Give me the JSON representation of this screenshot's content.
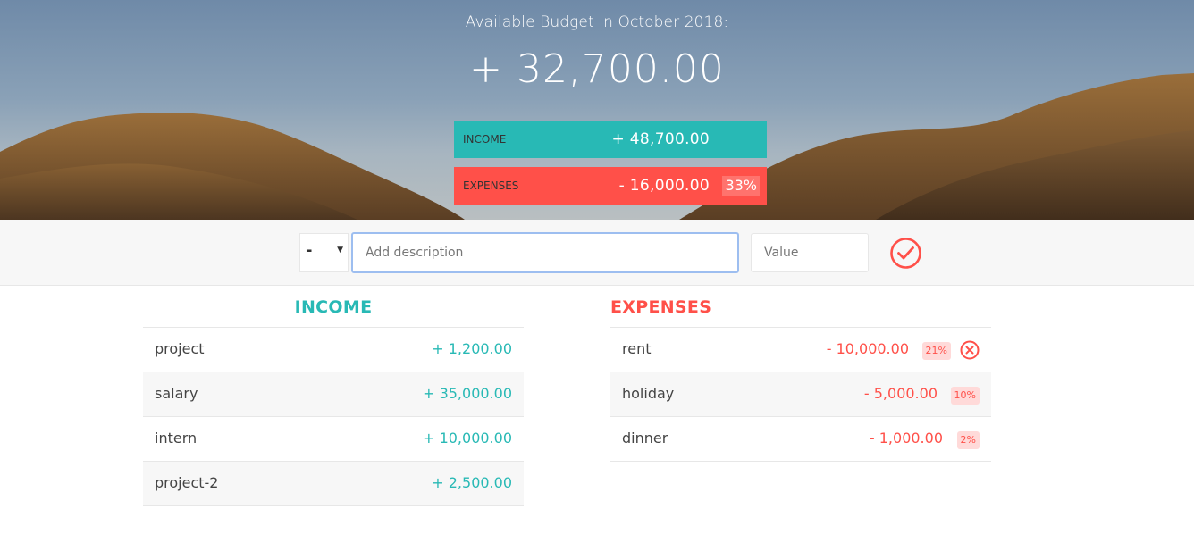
{
  "header": {
    "title": "Available Budget in October 2018:",
    "budget": "+ 32,700.00",
    "income": {
      "label": "INCOME",
      "value": "+ 48,700.00"
    },
    "expenses": {
      "label": "EXPENSES",
      "value": "- 16,000.00",
      "percentage": "33%"
    }
  },
  "add_form": {
    "type_selected": "-",
    "description_placeholder": "Add description",
    "value_placeholder": "Value"
  },
  "income": {
    "title": "INCOME",
    "items": [
      {
        "description": "project",
        "value": "+ 1,200.00"
      },
      {
        "description": "salary",
        "value": "+ 35,000.00"
      },
      {
        "description": "intern",
        "value": "+ 10,000.00"
      },
      {
        "description": "project-2",
        "value": "+ 2,500.00"
      }
    ]
  },
  "expenses": {
    "title": "EXPENSES",
    "items": [
      {
        "description": "rent",
        "value": "- 10,000.00",
        "percentage": "21%"
      },
      {
        "description": "holiday",
        "value": "- 5,000.00",
        "percentage": "10%"
      },
      {
        "description": "dinner",
        "value": "- 1,000.00",
        "percentage": "2%"
      }
    ]
  },
  "colors": {
    "income": "#28b9b5",
    "expense": "#ff5049",
    "hover_delete_icon": "close-circle-icon",
    "add_icon": "checkmark-circle-icon"
  }
}
